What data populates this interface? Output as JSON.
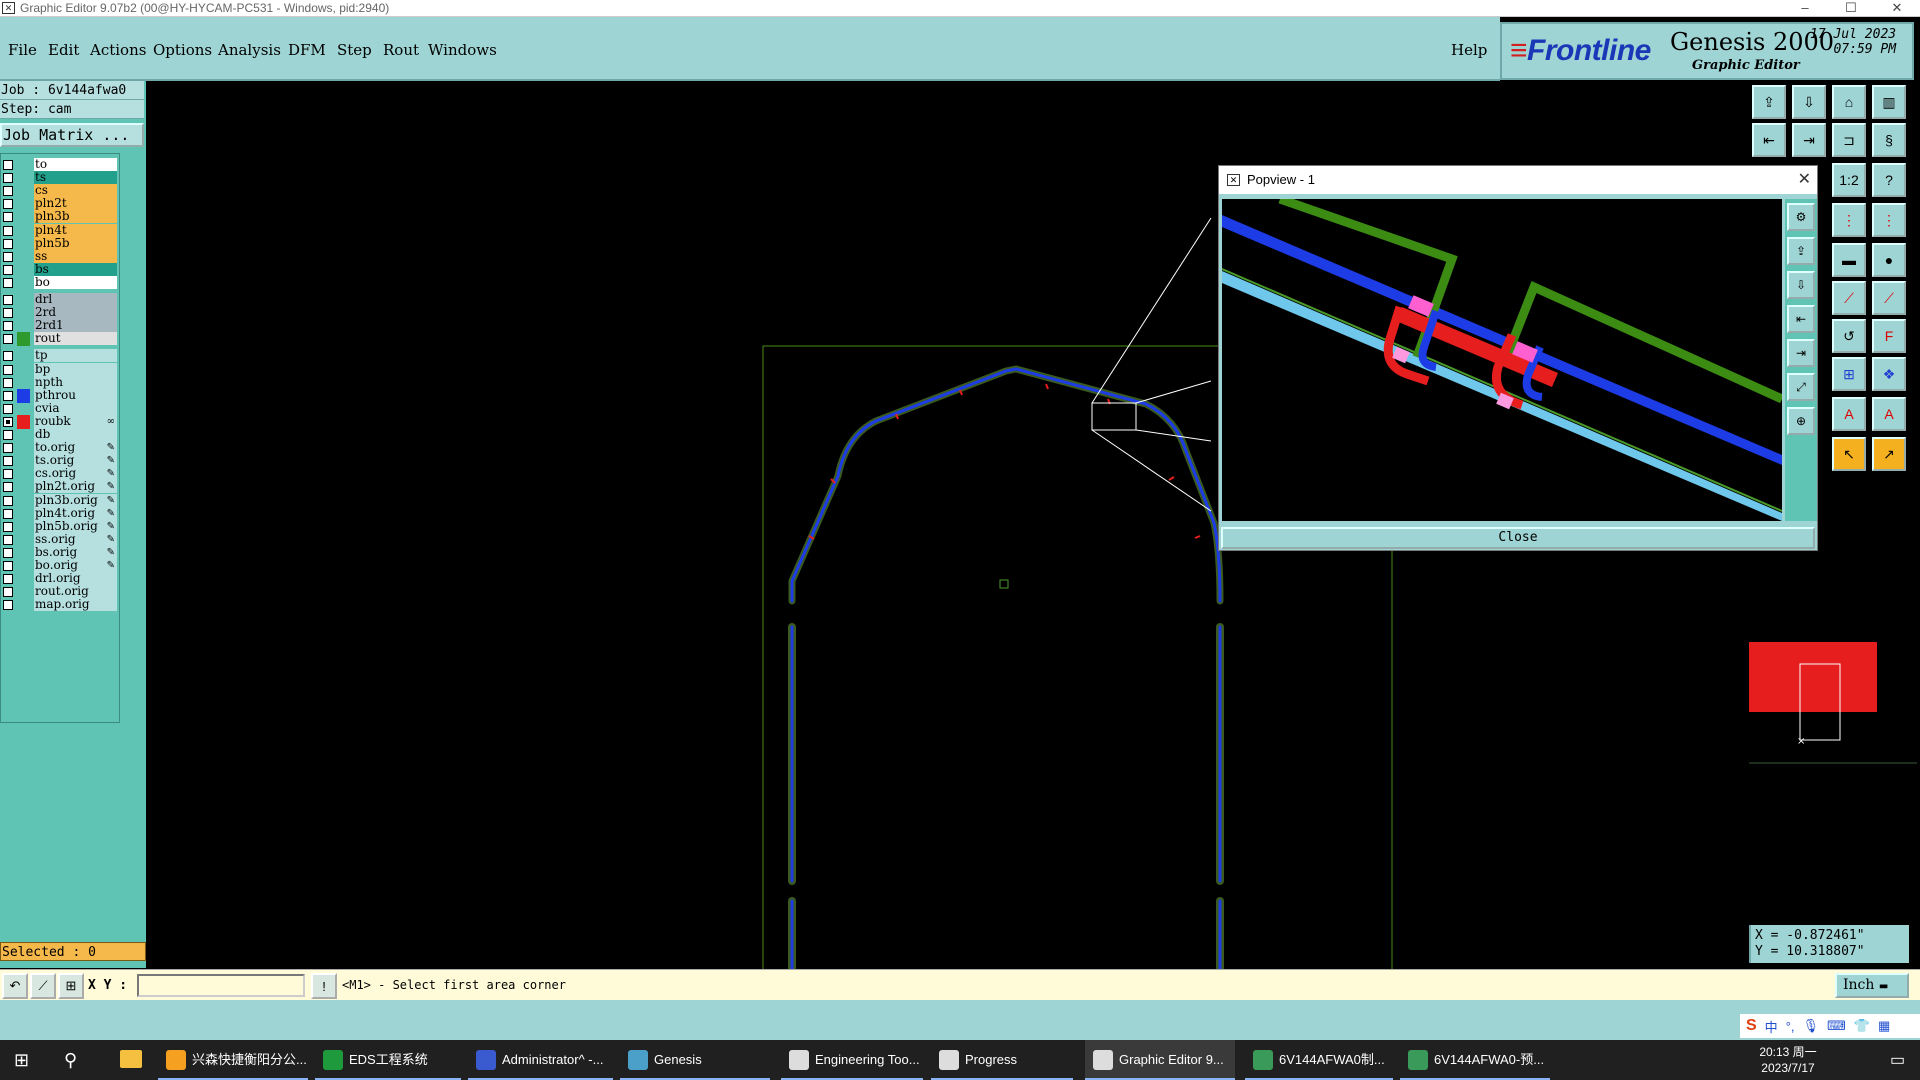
{
  "window": {
    "title": "Graphic Editor 9.07b2 (00@HY-HYCAM-PC531 - Windows, pid:2940)",
    "minimize": "–",
    "maximize": "☐",
    "close": "✕"
  },
  "menu": [
    {
      "label": "File"
    },
    {
      "label": "Edit"
    },
    {
      "label": "Actions"
    },
    {
      "label": "Options"
    },
    {
      "label": "Analysis"
    },
    {
      "label": "DFM"
    },
    {
      "label": "Step"
    },
    {
      "label": "Rout"
    },
    {
      "label": "Windows"
    }
  ],
  "help_label": "Help",
  "logo": {
    "brand": "Frontline",
    "product": "Genesis 2000",
    "subtitle": "Graphic Editor",
    "date": "17 Jul 2023",
    "time": "07:59 PM"
  },
  "job": {
    "job_line": "Job : 6v144afwa0",
    "step_line": "Step: cam",
    "matrix_button": "Job Matrix ..."
  },
  "layers": [
    {
      "name": "to",
      "color": "#ffffff",
      "swatch": ""
    },
    {
      "name": "ts",
      "color": "#23a08c",
      "swatch": ""
    },
    {
      "name": "cs",
      "color": "#f5b84a",
      "swatch": ""
    },
    {
      "name": "pln2t",
      "color": "#f5b84a",
      "swatch": ""
    },
    {
      "name": "pln3b",
      "color": "#f5b84a",
      "swatch": ""
    },
    {
      "name": "pln4t",
      "color": "#f5b84a",
      "swatch": ""
    },
    {
      "name": "pln5b",
      "color": "#f5b84a",
      "swatch": ""
    },
    {
      "name": "ss",
      "color": "#f5b84a",
      "swatch": ""
    },
    {
      "name": "bs",
      "color": "#23a08c",
      "swatch": ""
    },
    {
      "name": "bo",
      "color": "#ffffff",
      "swatch": ""
    },
    {
      "name": "drl",
      "color": "#a8b8c0",
      "swatch": ""
    },
    {
      "name": "2rd",
      "color": "#a8b8c0",
      "swatch": ""
    },
    {
      "name": "2rd1",
      "color": "#a8b8c0",
      "swatch": ""
    },
    {
      "name": "rout",
      "color": "#e0e0e0",
      "swatch": "#2e9a2e"
    },
    {
      "name": "tp",
      "color": "#b6e0e0",
      "swatch": ""
    },
    {
      "name": "bp",
      "color": "#b6e0e0",
      "swatch": ""
    },
    {
      "name": "npth",
      "color": "#b6e0e0",
      "swatch": ""
    },
    {
      "name": "pthrou",
      "color": "#b6e0e0",
      "swatch": "#1e3ce6"
    },
    {
      "name": "cvia",
      "color": "#b6e0e0",
      "swatch": ""
    },
    {
      "name": "roubk",
      "color": "#b6e0e0",
      "swatch": "#e61e1e",
      "checked": true,
      "mark": "∞"
    },
    {
      "name": "db",
      "color": "#b6e0e0",
      "swatch": ""
    },
    {
      "name": "to.orig",
      "color": "#b6e0e0",
      "swatch": "",
      "mark": "✎"
    },
    {
      "name": "ts.orig",
      "color": "#b6e0e0",
      "swatch": "",
      "mark": "✎"
    },
    {
      "name": "cs.orig",
      "color": "#b6e0e0",
      "swatch": "",
      "mark": "✎"
    },
    {
      "name": "pln2t.orig",
      "color": "#b6e0e0",
      "swatch": "",
      "mark": "✎"
    },
    {
      "name": "pln3b.orig",
      "color": "#b6e0e0",
      "swatch": "",
      "mark": "✎"
    },
    {
      "name": "pln4t.orig",
      "color": "#b6e0e0",
      "swatch": "",
      "mark": "✎"
    },
    {
      "name": "pln5b.orig",
      "color": "#b6e0e0",
      "swatch": "",
      "mark": "✎"
    },
    {
      "name": "ss.orig",
      "color": "#b6e0e0",
      "swatch": "",
      "mark": "✎"
    },
    {
      "name": "bs.orig",
      "color": "#b6e0e0",
      "swatch": "",
      "mark": "✎"
    },
    {
      "name": "bo.orig",
      "color": "#b6e0e0",
      "swatch": "",
      "mark": "✎"
    },
    {
      "name": "drl.orig",
      "color": "#b6e0e0",
      "swatch": ""
    },
    {
      "name": "rout.orig",
      "color": "#b6e0e0",
      "swatch": ""
    },
    {
      "name": "map.orig",
      "color": "#b6e0e0",
      "swatch": ""
    }
  ],
  "selected_label": "Selected : 0",
  "popview": {
    "title": "Popview - 1",
    "close_x": "✕",
    "close_button": "Close"
  },
  "coords": {
    "x": "X = -0.872461\"",
    "y": "Y = 10.318807\""
  },
  "command": {
    "xy_label": "X Y :",
    "xy_value": "",
    "prompt": "<M1> - Select first area corner",
    "unit": "Inch"
  },
  "taskbar": {
    "tasks": [
      {
        "label": "兴森快捷衡阳分公...",
        "icon": "#f5a020"
      },
      {
        "label": "EDS工程系统",
        "icon": "#1e9a3c"
      },
      {
        "label": "Administrator^ -...",
        "icon": "#3a5ad0"
      },
      {
        "label": "Genesis",
        "icon": "#4aa0c8"
      },
      {
        "label": "Engineering Too...",
        "icon": "#dddddd"
      },
      {
        "label": "Progress",
        "icon": "#dddddd"
      },
      {
        "label": "Graphic Editor 9...",
        "icon": "#dddddd",
        "active": true
      },
      {
        "label": "6V144AFWA0制...",
        "icon": "#3a9a5a"
      },
      {
        "label": "6V144AFWA0-预...",
        "icon": "#3a9a5a"
      }
    ],
    "clock_time": "20:13 周一",
    "clock_date": "2023/7/17",
    "ime_label": "中"
  },
  "colors": {
    "ui_teal": "#9fd4d4",
    "panel_green": "#5fc4b4",
    "layer_orange": "#f5b84a",
    "rout_green": "#3c8c14",
    "pthrou_blue": "#1e3ce6",
    "roubk_red": "#e61e1e",
    "outline_green": "#4a9a2a"
  }
}
